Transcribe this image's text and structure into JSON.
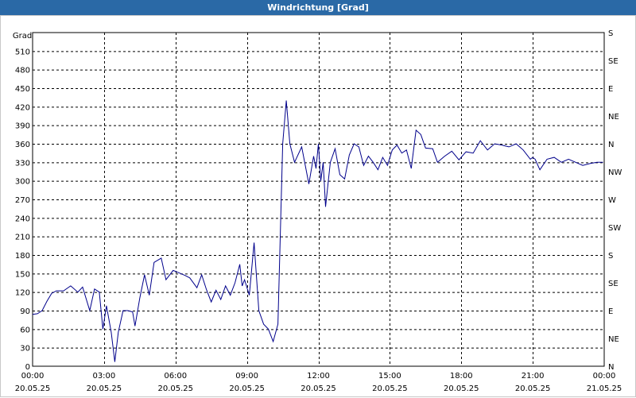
{
  "window": {
    "title": "Windrichtung [Grad]"
  },
  "chart_data": {
    "type": "line",
    "title": "Windrichtung [Grad]",
    "ylabel": "Grad",
    "ylim": [
      0,
      540
    ],
    "yticks": [
      0,
      30,
      60,
      90,
      120,
      150,
      180,
      210,
      240,
      270,
      300,
      330,
      360,
      390,
      420,
      450,
      480,
      510
    ],
    "right_axis_labels": [
      "N",
      "NE",
      "E",
      "SE",
      "S",
      "SW",
      "W",
      "NW",
      "N",
      "NE",
      "E",
      "SE",
      "S"
    ],
    "right_axis_values": [
      0,
      45,
      90,
      135,
      180,
      225,
      270,
      315,
      360,
      405,
      450,
      495,
      540
    ],
    "x_start": "20.05.25 00:00",
    "x_end": "21.05.25 00:00",
    "xlim_hours": [
      0,
      24
    ],
    "xticks": [
      {
        "time": "00:00",
        "date": "20.05.25"
      },
      {
        "time": "03:00",
        "date": "20.05.25"
      },
      {
        "time": "06:00",
        "date": "20.05.25"
      },
      {
        "time": "09:00",
        "date": "20.05.25"
      },
      {
        "time": "12:00",
        "date": "20.05.25"
      },
      {
        "time": "15:00",
        "date": "20.05.25"
      },
      {
        "time": "18:00",
        "date": "20.05.25"
      },
      {
        "time": "21:00",
        "date": "20.05.25"
      },
      {
        "time": "00:00",
        "date": "21.05.25"
      }
    ],
    "grid": true,
    "colors": {
      "line": "#00008b",
      "grid": "#000000",
      "title_bar": "#2a69a6"
    },
    "series": [
      {
        "x": [
          0,
          0.2,
          0.4,
          0.6,
          0.8,
          1.0,
          1.3,
          1.6,
          1.9,
          2.1,
          2.4,
          2.6,
          2.8,
          2.95,
          3.1,
          3.3,
          3.45,
          3.6,
          3.8,
          4.0,
          4.2,
          4.3,
          4.5,
          4.7,
          4.9,
          5.1,
          5.4,
          5.6,
          5.9,
          6.1,
          6.4,
          6.6,
          6.9,
          7.1,
          7.3,
          7.5,
          7.7,
          7.9,
          8.1,
          8.3,
          8.5,
          8.7,
          8.8,
          8.9,
          9.1,
          9.3,
          9.5,
          9.7,
          9.9,
          10.1,
          10.3,
          10.5,
          10.65,
          10.8,
          11.0,
          11.3,
          11.6,
          11.8,
          11.9,
          12.0,
          12.1,
          12.2,
          12.3,
          12.5,
          12.7,
          12.9,
          13.1,
          13.3,
          13.5,
          13.7,
          13.9,
          14.1,
          14.3,
          14.5,
          14.7,
          14.9,
          15.1,
          15.3,
          15.5,
          15.7,
          15.9,
          16.1,
          16.3,
          16.5,
          16.8,
          17.0,
          17.3,
          17.6,
          17.9,
          18.2,
          18.5,
          18.8,
          19.1,
          19.4,
          19.7,
          20.0,
          20.3,
          20.6,
          20.9,
          21.0,
          21.1,
          21.3,
          21.6,
          21.9,
          22.2,
          22.5,
          22.8,
          23.1,
          23.4,
          23.7,
          23.95
        ],
        "y": [
          84,
          85,
          90,
          105,
          118,
          122,
          122,
          130,
          120,
          128,
          90,
          125,
          120,
          60,
          98,
          55,
          7,
          55,
          90,
          90,
          88,
          65,
          110,
          148,
          115,
          168,
          175,
          140,
          155,
          152,
          147,
          143,
          127,
          148,
          124,
          104,
          123,
          108,
          130,
          115,
          135,
          165,
          130,
          140,
          115,
          200,
          90,
          68,
          60,
          40,
          68,
          360,
          430,
          360,
          330,
          355,
          295,
          340,
          320,
          360,
          300,
          330,
          258,
          330,
          352,
          310,
          303,
          342,
          360,
          355,
          325,
          340,
          330,
          318,
          338,
          325,
          350,
          358,
          345,
          350,
          320,
          382,
          375,
          353,
          352,
          330,
          340,
          348,
          334,
          347,
          345,
          365,
          350,
          360,
          358,
          355,
          360,
          350,
          335,
          338,
          335,
          318,
          335,
          338,
          330,
          335,
          330,
          325,
          328,
          330,
          330
        ],
        "color": "#00008b"
      }
    ]
  }
}
